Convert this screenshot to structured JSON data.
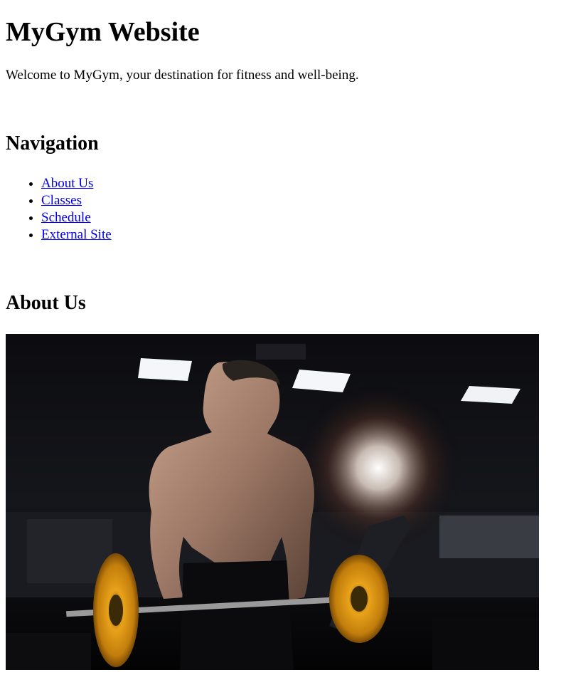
{
  "header": {
    "title": "MyGym Website",
    "intro": "Welcome to MyGym, your destination for fitness and well-being."
  },
  "navigation": {
    "heading": "Navigation",
    "links": [
      {
        "label": "About Us"
      },
      {
        "label": "Classes"
      },
      {
        "label": "Schedule"
      },
      {
        "label": "External Site"
      }
    ]
  },
  "about": {
    "heading": "About Us",
    "image": "photo of a muscular man lifting a barbell with orange plates in a dark gym"
  },
  "colors": {
    "link": "#0000ee",
    "plate": "#e8a21a"
  }
}
